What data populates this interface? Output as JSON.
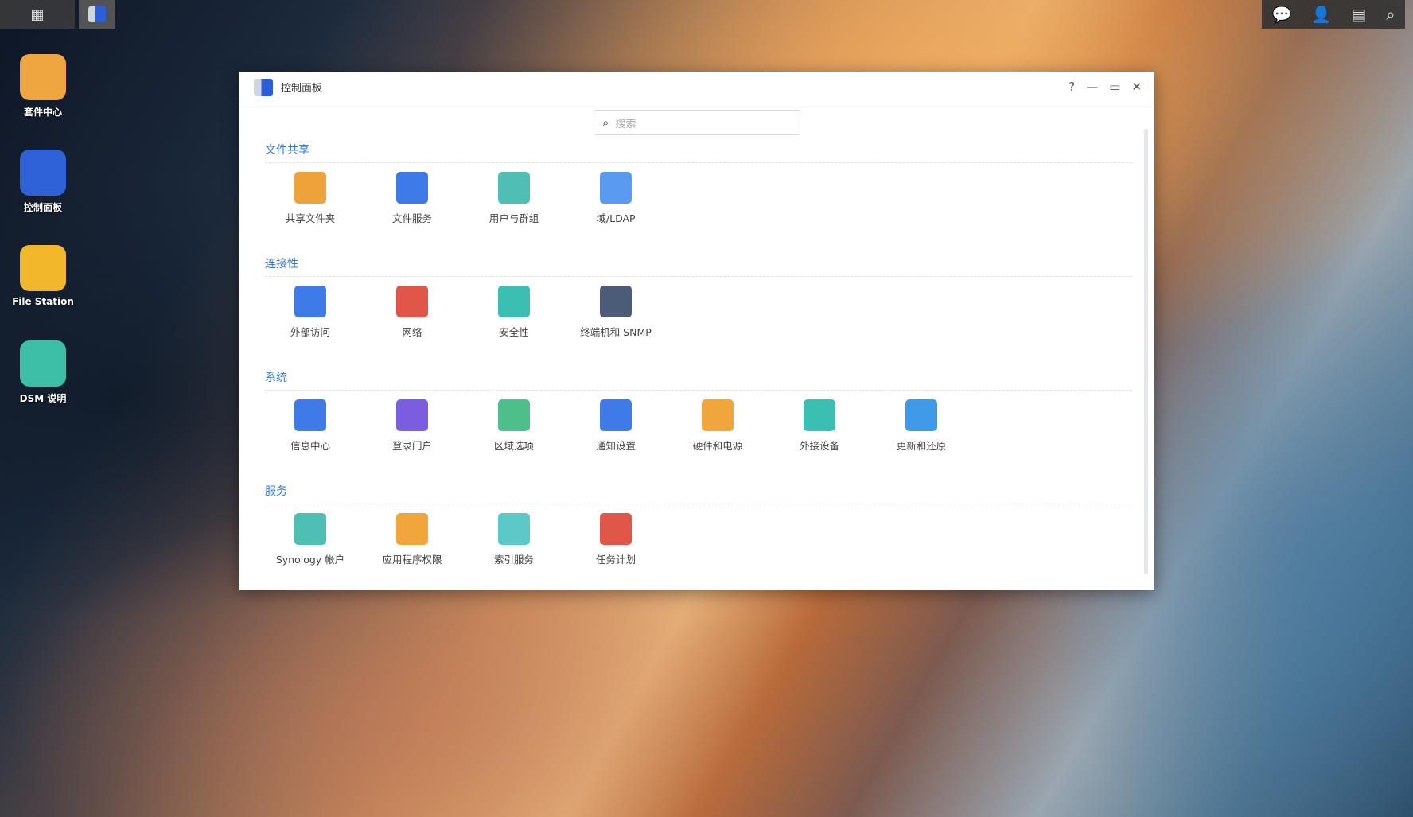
{
  "taskbar": {
    "icons": [
      "apps-grid-icon",
      "control-panel-icon"
    ]
  },
  "tray": {
    "icons": [
      "chat-icon",
      "user-icon",
      "widgets-icon",
      "search-icon"
    ]
  },
  "desktop": [
    {
      "label": "套件中心",
      "color": "#f0a640"
    },
    {
      "label": "控制面板",
      "color": "#2f62d9"
    },
    {
      "label": "File Station",
      "color": "#f3b72b"
    },
    {
      "label": "DSM 说明",
      "color": "#3cbfa6"
    }
  ],
  "window": {
    "title": "控制面板",
    "controls": [
      "?",
      "—",
      "▭",
      "✕"
    ],
    "search_placeholder": "搜索",
    "sections": [
      {
        "title": "文件共享",
        "items": [
          {
            "label": "共享文件夹",
            "color": "#eea23a"
          },
          {
            "label": "文件服务",
            "color": "#3f7be8"
          },
          {
            "label": "用户与群组",
            "color": "#4fbfb3"
          },
          {
            "label": "域/LDAP",
            "color": "#5a9af0"
          }
        ]
      },
      {
        "title": "连接性",
        "items": [
          {
            "label": "外部访问",
            "color": "#3f7be8"
          },
          {
            "label": "网络",
            "color": "#e0574a"
          },
          {
            "label": "安全性",
            "color": "#3cbfb3"
          },
          {
            "label": "终端机和 SNMP",
            "color": "#4c5c78"
          }
        ]
      },
      {
        "title": "系统",
        "items": [
          {
            "label": "信息中心",
            "color": "#3f7be8"
          },
          {
            "label": "登录门户",
            "color": "#7b5ee0"
          },
          {
            "label": "区域选项",
            "color": "#4cbf8a"
          },
          {
            "label": "通知设置",
            "color": "#3f7be8"
          },
          {
            "label": "硬件和电源",
            "color": "#f0a63a"
          },
          {
            "label": "外接设备",
            "color": "#3cbfb3"
          },
          {
            "label": "更新和还原",
            "color": "#3f9be8"
          }
        ]
      },
      {
        "title": "服务",
        "items": [
          {
            "label": "Synology 帐户",
            "color": "#4fbfb3"
          },
          {
            "label": "应用程序权限",
            "color": "#f0a63a"
          },
          {
            "label": "索引服务",
            "color": "#5cc8c8"
          },
          {
            "label": "任务计划",
            "color": "#e0574a"
          }
        ]
      }
    ]
  }
}
